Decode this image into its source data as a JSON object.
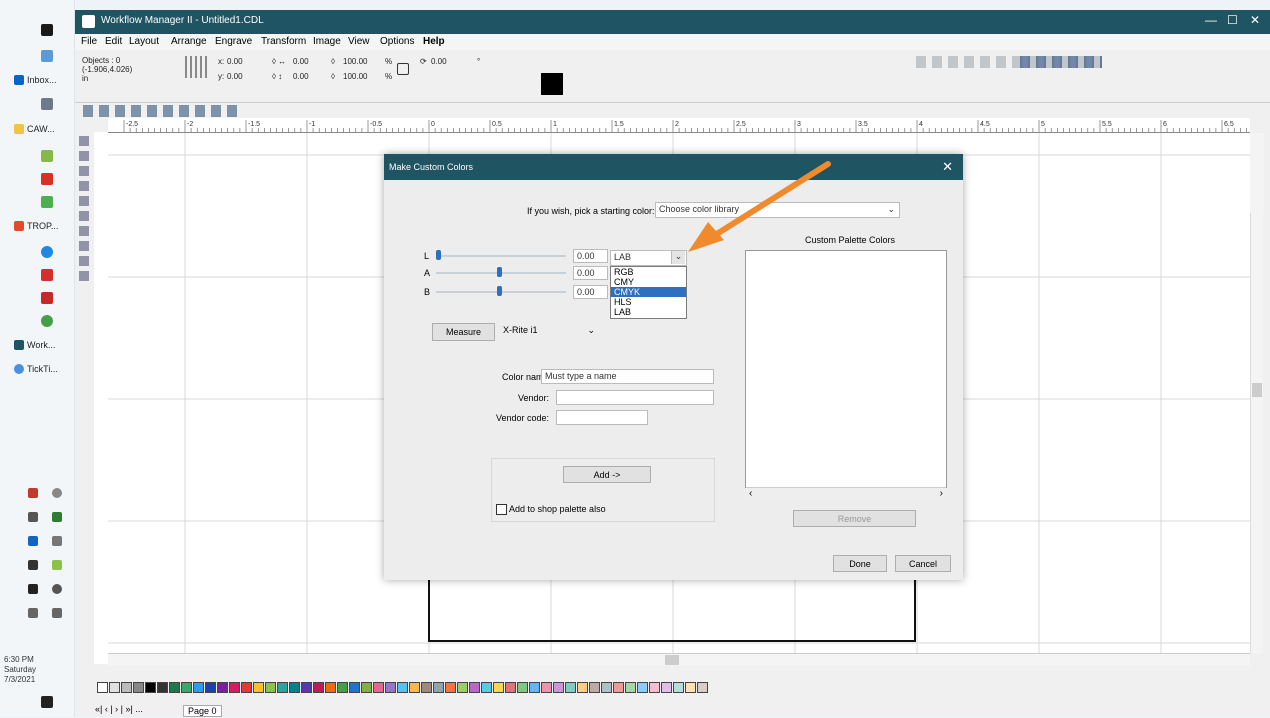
{
  "app": {
    "title": "Workflow Manager II - Untitled1.CDL",
    "menu": [
      "File",
      "Edit",
      "Layout",
      "Arrange",
      "Engrave",
      "Transform",
      "Image",
      "View",
      "Options",
      "Help"
    ]
  },
  "toolbar": {
    "objects_label": "Objects : 0",
    "coords": "(-1.906,4.026)",
    "units": "in",
    "x_label": "x:",
    "x_value": "0.00",
    "y_label": "y:",
    "y_value": "0.00",
    "w_value": "0.00",
    "h_value": "0.00",
    "scale_x": "100.00",
    "scale_y": "100.00",
    "pct": "%",
    "rotation": "0.00",
    "deg": "°"
  },
  "ruler_labels": [
    "-2.5",
    "-2",
    "-1.5",
    "-1",
    "-0.5",
    "0",
    "0.5",
    "1",
    "1.5",
    "2",
    "2.5",
    "3",
    "3.5",
    "4",
    "4.5",
    "5",
    "5.5",
    "6",
    "6.5"
  ],
  "taskbar": {
    "items": [
      {
        "label": "Inbox..."
      },
      {
        "label": "CAW..."
      },
      {
        "label": "TROP..."
      },
      {
        "label": "Work..."
      },
      {
        "label": "TickTi..."
      }
    ],
    "clock_time": "6:30 PM",
    "clock_day": "Saturday",
    "clock_date": "7/3/2021"
  },
  "dialog": {
    "title": "Make Custom Colors",
    "pick_label": "If you wish, pick a starting color:",
    "pick_value": "Choose color library",
    "channels": [
      {
        "label": "L",
        "value": "0.00",
        "level": 0.0
      },
      {
        "label": "A",
        "value": "0.00",
        "level": 0.5
      },
      {
        "label": "B",
        "value": "0.00",
        "level": 0.5
      }
    ],
    "model_selected": "LAB",
    "model_options": [
      "RGB",
      "CMY",
      "CMYK",
      "HLS",
      "LAB"
    ],
    "model_highlighted": "CMYK",
    "measure_label": "Measure",
    "device_value": "X-Rite i1",
    "color_name_label": "Color name:",
    "color_name_value": "Must type a name",
    "vendor_label": "Vendor:",
    "vendor_value": "",
    "vendor_code_label": "Vendor code:",
    "vendor_code_value": "",
    "add_label": "Add ->",
    "shop_palette_label": "Add to shop palette also",
    "custom_palette_title": "Custom Palette Colors",
    "remove_label": "Remove",
    "done_label": "Done",
    "cancel_label": "Cancel"
  },
  "page": {
    "tab": "Page 0"
  },
  "colors": {
    "titlebar": "#1f5462",
    "annotation_arrow": "#f08a2c",
    "selection": "#2e6fbf"
  }
}
